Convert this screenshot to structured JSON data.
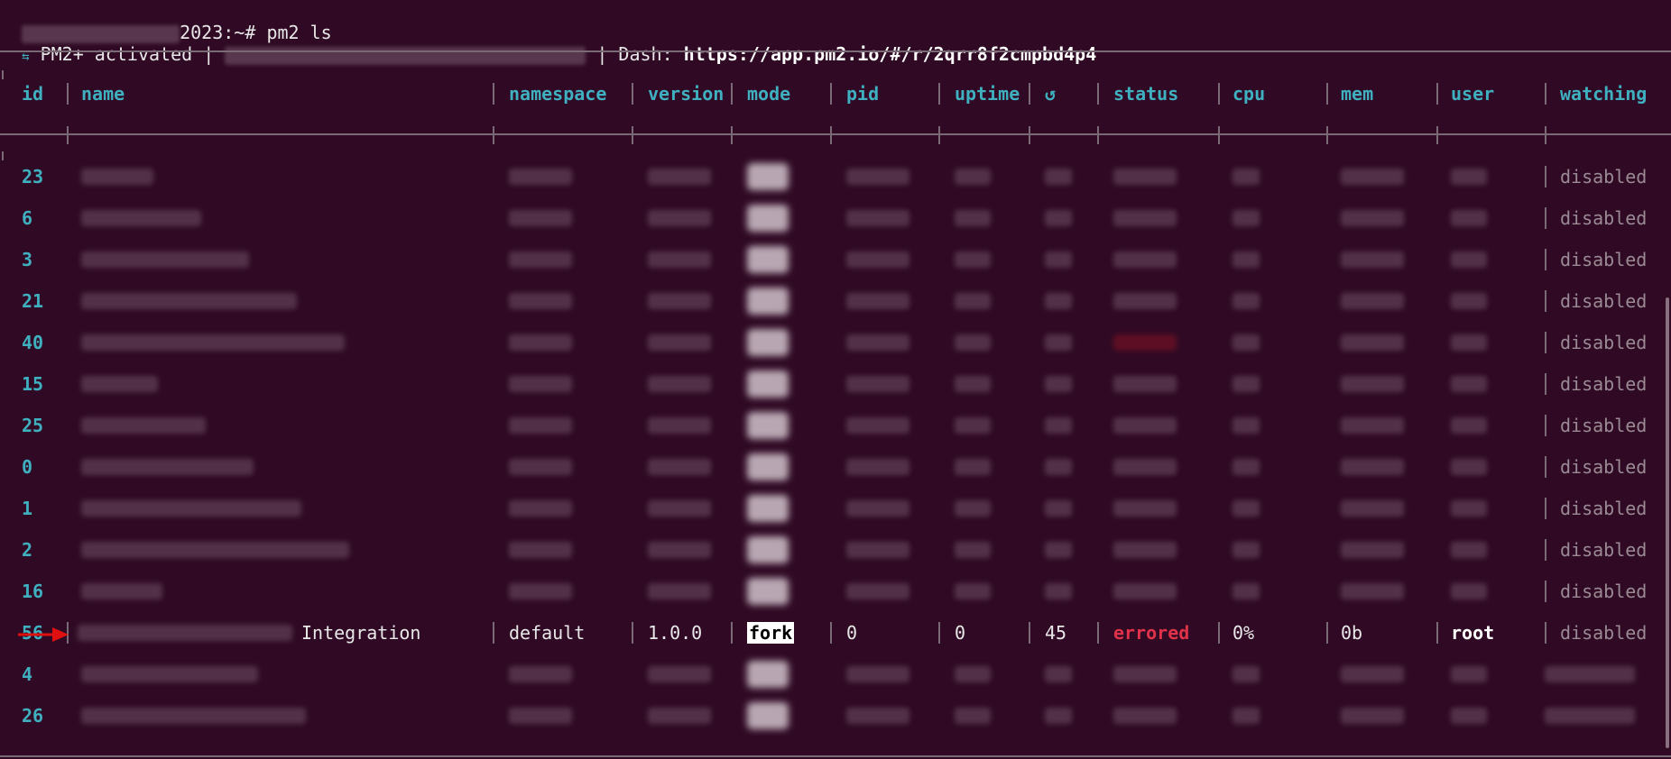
{
  "prompt": {
    "host_suffix": "2023:~#",
    "command": "pm2 ls"
  },
  "banner": {
    "glyph": "⇆",
    "text_prefix": "PM2+ activated |",
    "dash_label": "| Dash:",
    "dash_url": "https://app.pm2.io/#/r/2qrr8f2cmpbd4p4"
  },
  "table": {
    "headers": [
      "id",
      "name",
      "namespace",
      "version",
      "mode",
      "pid",
      "uptime",
      "↺",
      "status",
      "cpu",
      "mem",
      "user",
      "watching"
    ],
    "rows": [
      {
        "id": "23",
        "watching": "disabled"
      },
      {
        "id": "6",
        "watching": "disabled"
      },
      {
        "id": "3",
        "watching": "disabled"
      },
      {
        "id": "21",
        "watching": "disabled"
      },
      {
        "id": "40",
        "watching": "disabled"
      },
      {
        "id": "15",
        "watching": "disabled"
      },
      {
        "id": "25",
        "watching": "disabled"
      },
      {
        "id": "0",
        "watching": "disabled"
      },
      {
        "id": "1",
        "watching": "disabled"
      },
      {
        "id": "2",
        "watching": "disabled"
      },
      {
        "id": "16",
        "watching": "disabled"
      }
    ],
    "highlighted_row": {
      "id": "56",
      "name_suffix": "Integration",
      "namespace": "default",
      "version": "1.0.0",
      "mode": "fork",
      "pid": "0",
      "uptime": "0",
      "restarts": "45",
      "status": "errored",
      "cpu": "0%",
      "mem": "0b",
      "user": "root",
      "watching": "disabled"
    },
    "tail_rows": [
      {
        "id": "4"
      },
      {
        "id": "26"
      }
    ]
  },
  "colors": {
    "background": "#300a24",
    "header": "#3fb0c0",
    "error": "#e0334a",
    "arrow": "#e01010"
  }
}
